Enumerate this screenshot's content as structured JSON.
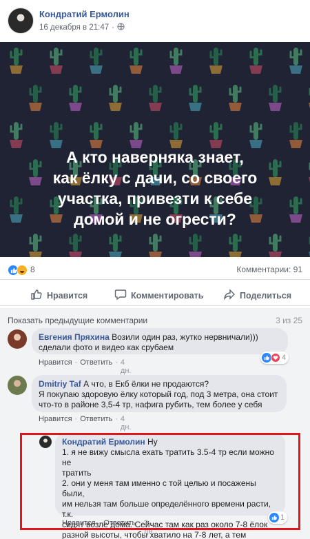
{
  "post": {
    "author": "Кондратий Ермолин",
    "timestamp": "16 декабря в 21:47",
    "separator": "·",
    "privacy_icon": "globe-icon",
    "text": "А кто наверняка знает,\nкак ёлку с дачи, со своего\nучастка, привезти к себе\nдомой и не огрести?",
    "background": "#1f2333"
  },
  "reactions": {
    "count": "8",
    "comments": "Комментарии: 91"
  },
  "actions": {
    "like": "Нравится",
    "comment": "Комментировать",
    "share": "Поделиться"
  },
  "comments_header": {
    "previous": "Показать предыдущие комментарии",
    "counter": "3 из 25"
  },
  "comments": [
    {
      "author": "Евгения Пряхина",
      "text": "Возили один раз, жутко нервничали)))\nсделали фото и видео как срубаем",
      "like": "Нравится",
      "reply": "Ответить",
      "time": "4 дн.",
      "reactions_count": "4"
    },
    {
      "author": "Dmitriy Taf",
      "text": "А что, в Екб ёлки не продаются?\nЯ покупаю здоровую ёлку который год, под 3 метра, она стоит\nчто-то в районе 3,5-4 тр, нафига рубить, тем более у себя",
      "like": "Нравится",
      "reply": "Ответить",
      "time": "4 дн."
    },
    {
      "author": "Кондратий Ермолин",
      "text_first": "Ну",
      "text": "1. я не вижу смысла ехать тратить 3.5-4 тр если можно не\nтратить\n2. они у меня там именно с той целью и посажены были,\nим нельзя там больше определённого времени расти, т.к.\nсидят возле дома. Сейчас там как раз около 7-8 ёлок\nразной высоты, чтобы хватило на 7-8 лет, а тем временем\nновые подрастут.",
      "like": "Нравится",
      "reply": "Ответить",
      "time": "3 дн.",
      "reactions_count": "1"
    }
  ],
  "colors": {
    "link": "#385898",
    "accent": "#2d88ff",
    "highlight": "#e0141b"
  }
}
